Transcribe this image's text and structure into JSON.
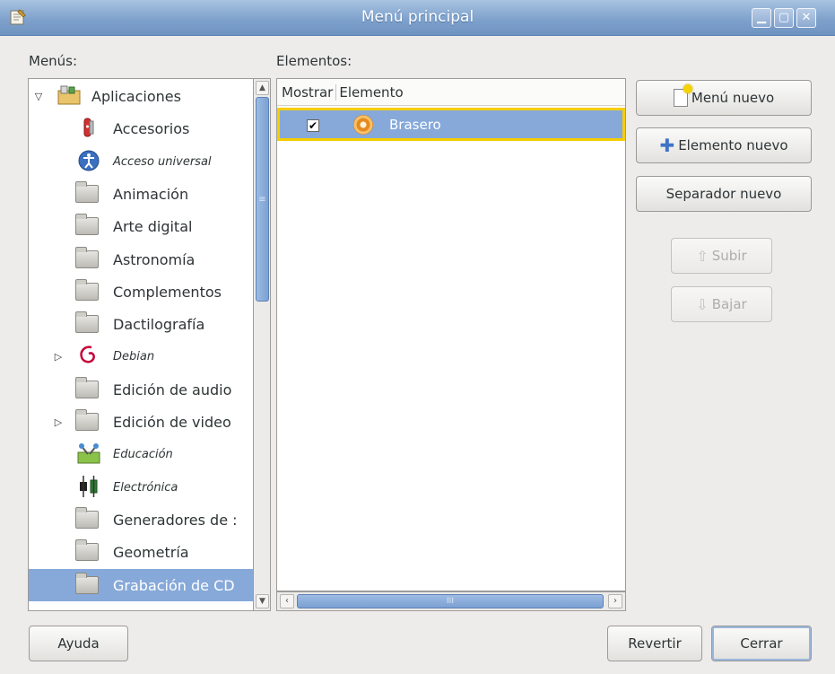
{
  "window": {
    "title": "Menú principal",
    "controls": [
      "minimize",
      "maximize",
      "close"
    ]
  },
  "menus_label": "Menús:",
  "menus_label_mnemonic": "M",
  "elements_label": "Elementos:",
  "elements_label_mnemonic": "E",
  "tree": {
    "root": {
      "label": "Aplicaciones",
      "expanded": true,
      "icon": "applications-icon"
    },
    "items": [
      {
        "label": "Accesorios",
        "icon": "accessories-icon",
        "italic": false,
        "expander": false
      },
      {
        "label": "Acceso universal",
        "icon": "accessibility-icon",
        "italic": true,
        "expander": false
      },
      {
        "label": "Animación",
        "icon": "folder-icon",
        "italic": false,
        "expander": false
      },
      {
        "label": "Arte digital",
        "icon": "folder-icon",
        "italic": false,
        "expander": false
      },
      {
        "label": "Astronomía",
        "icon": "folder-icon",
        "italic": false,
        "expander": false
      },
      {
        "label": "Complementos",
        "icon": "folder-icon",
        "italic": false,
        "expander": false
      },
      {
        "label": "Dactilografía",
        "icon": "folder-icon",
        "italic": false,
        "expander": false
      },
      {
        "label": "Debian",
        "icon": "debian-icon",
        "italic": true,
        "expander": true
      },
      {
        "label": "Edición de audio",
        "icon": "folder-icon",
        "italic": false,
        "expander": false
      },
      {
        "label": "Edición de video",
        "icon": "folder-icon",
        "italic": false,
        "expander": true
      },
      {
        "label": "Educación",
        "icon": "education-icon",
        "italic": true,
        "expander": false
      },
      {
        "label": "Electrónica",
        "icon": "electronics-icon",
        "italic": true,
        "expander": false
      },
      {
        "label": "Generadores de :",
        "icon": "folder-icon",
        "italic": false,
        "expander": false
      },
      {
        "label": "Geometría",
        "icon": "folder-icon",
        "italic": false,
        "expander": false
      },
      {
        "label": "Grabación de CD",
        "icon": "folder-icon",
        "italic": false,
        "expander": false,
        "selected": true
      }
    ]
  },
  "list": {
    "columns": [
      "Mostrar",
      "Elemento"
    ],
    "rows": [
      {
        "show": true,
        "label": "Brasero",
        "icon": "brasero-icon",
        "selected": true
      }
    ]
  },
  "buttons": {
    "new_menu": "Menú nuevo",
    "new_item": "Elemento nuevo",
    "new_separator": "Separador nuevo",
    "move_up": "Subir",
    "move_down": "Bajar",
    "help": "Ayuda",
    "revert": "Revertir",
    "close": "Cerrar"
  },
  "colors": {
    "selection": "#86a9d9",
    "highlight_border": "#f6ce00",
    "titlebar": "#7fa2cc"
  }
}
